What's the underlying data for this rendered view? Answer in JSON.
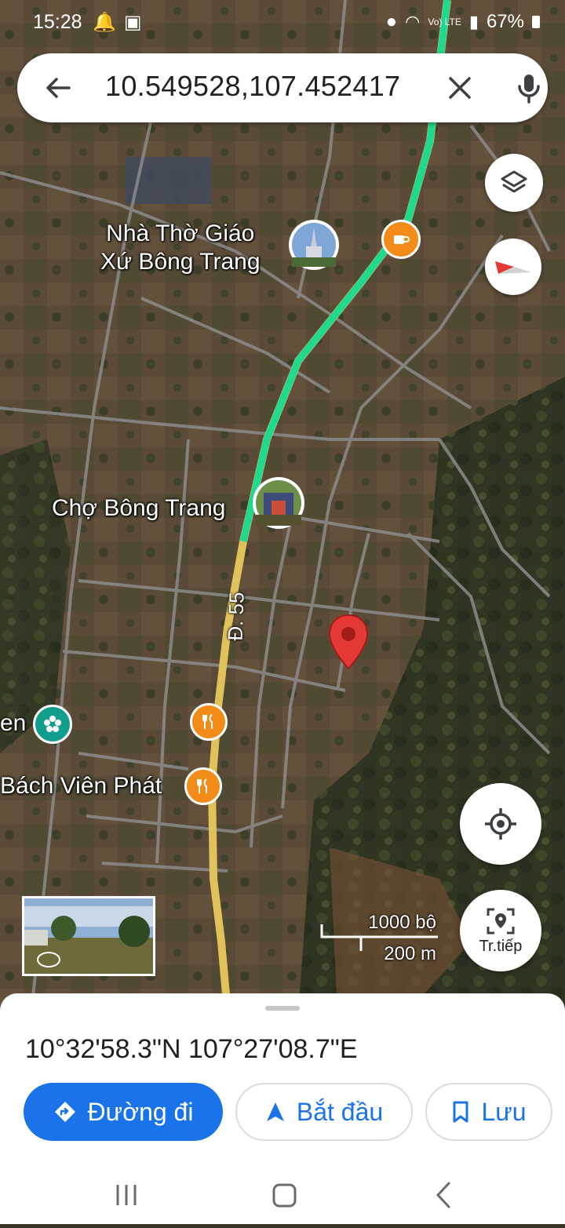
{
  "status_bar": {
    "time": "15:28",
    "network_label": "Vo) LTE",
    "battery": "67%"
  },
  "search": {
    "query": "10.549528,107.452417"
  },
  "map": {
    "type": "satellite",
    "road_label": "Đ. 55",
    "places": [
      {
        "name": "Nhà Thờ Giáo\nXứ Bông Trang",
        "icon": "church-photo"
      },
      {
        "name": "Chợ Bông Trang",
        "icon": "market-photo"
      },
      {
        "name": "en",
        "icon": "flower-icon"
      },
      {
        "name": "Bách Viên Phát",
        "icon": "restaurant-icon"
      }
    ],
    "scale": {
      "imperial": "1000 bộ",
      "metric": "200 m"
    },
    "live_view_label": "Tr.tiếp",
    "colors": {
      "route": "#1ed98e",
      "pin": "#e53935",
      "orange_poi": "#f28b18"
    }
  },
  "sheet": {
    "coordinates": "10°32'58.3\"N 107°27'08.7\"E",
    "actions": {
      "directions": "Đường đi",
      "start": "Bắt đầu",
      "save": "Lưu"
    }
  }
}
